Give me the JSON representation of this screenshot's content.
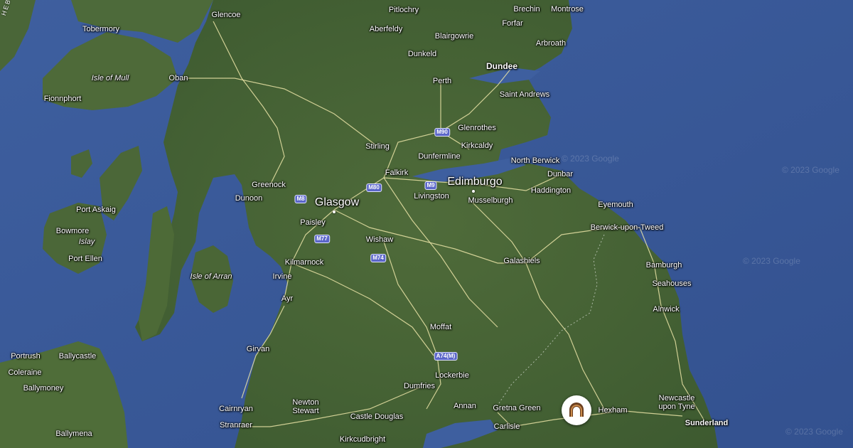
{
  "map": {
    "region_label": "HEBRI",
    "watermark": "© 2023 Google",
    "cities": {
      "glasgow": "Glasgow",
      "edinburgh": "Edimburgo",
      "dundee": "Dundee"
    },
    "towns": [
      "Glencoe",
      "Pitlochry",
      "Brechin",
      "Montrose",
      "Tobermory",
      "Aberfeldy",
      "Forfar",
      "Blairgowrie",
      "Arbroath",
      "Dunkeld",
      "Isle of Mull",
      "Oban",
      "Perth",
      "Fionnphort",
      "Saint Andrews",
      "Glenrothes",
      "Stirling",
      "Kirkcaldy",
      "Dunfermline",
      "North Berwick",
      "Dunbar",
      "Falkirk",
      "Greenock",
      "Livingston",
      "Haddington",
      "Dunoon",
      "Musselburgh",
      "Port Askaig",
      "Paisley",
      "Eyemouth",
      "Bowmore",
      "Islay",
      "Wishaw",
      "Berwick-upon-Tweed",
      "Port Ellen",
      "Kilmarnock",
      "Galashiels",
      "Bamburgh",
      "Isle of Arran",
      "Irvine",
      "Seahouses",
      "Ayr",
      "Alnwick",
      "Moffat",
      "Girvan",
      "Portrush",
      "Ballycastle",
      "Lockerbie",
      "Coleraine",
      "Ballymoney",
      "Dumfries",
      "Newcastle upon Tyne",
      "Newton Stewart",
      "Cairnryan",
      "Annan",
      "Gretna Green",
      "Hexham",
      "Castle Douglas",
      "Sunderland",
      "Stranraer",
      "Carlisle",
      "Ballymena",
      "Kirkcudbright"
    ],
    "roads": [
      "M8",
      "M80",
      "M90",
      "M9",
      "M77",
      "M74",
      "A74(M)"
    ],
    "poi": {
      "icon": "roman-arch-icon"
    }
  }
}
